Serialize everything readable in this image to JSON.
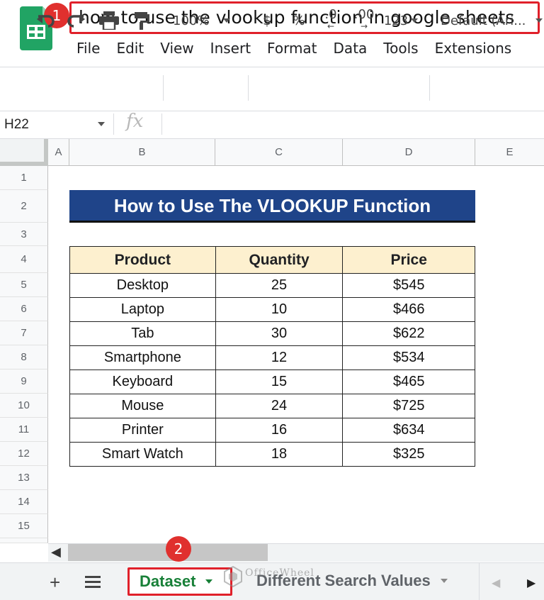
{
  "document": {
    "title": "how to use the vlookup function in google sheets"
  },
  "annotations": {
    "step1": "1",
    "step2": "2"
  },
  "menu": [
    "File",
    "Edit",
    "View",
    "Insert",
    "Format",
    "Data",
    "Tools",
    "Extensions"
  ],
  "toolbar": {
    "zoom": "100%",
    "currency": "$",
    "percent": "%",
    "decrease_decimal": ".0",
    "increase_decimal": ".00",
    "number_format": "123",
    "font": "Default (Ari..."
  },
  "formula_bar": {
    "cell_ref": "H22",
    "fx_label": "fx",
    "value": ""
  },
  "columns": [
    "A",
    "B",
    "C",
    "D",
    "E"
  ],
  "rows": [
    "1",
    "2",
    "3",
    "4",
    "5",
    "6",
    "7",
    "8",
    "9",
    "10",
    "11",
    "12",
    "13",
    "14",
    "15"
  ],
  "banner": "How to Use The VLOOKUP Function",
  "table": {
    "headers": [
      "Product",
      "Quantity",
      "Price"
    ],
    "rows": [
      [
        "Desktop",
        "25",
        "$545"
      ],
      [
        "Laptop",
        "10",
        "$466"
      ],
      [
        "Tab",
        "30",
        "$622"
      ],
      [
        "Smartphone",
        "12",
        "$534"
      ],
      [
        "Keyboard",
        "15",
        "$465"
      ],
      [
        "Mouse",
        "24",
        "$725"
      ],
      [
        "Printer",
        "16",
        "$634"
      ],
      [
        "Smart Watch",
        "18",
        "$325"
      ]
    ]
  },
  "sheets": [
    "Dataset",
    "Different Search Values"
  ],
  "watermark": "OfficeWheel",
  "colors": {
    "banner_bg": "#1f4489",
    "header_fill": "#fdf0cf",
    "highlight": "#e0202a",
    "active_tab": "#188038"
  }
}
